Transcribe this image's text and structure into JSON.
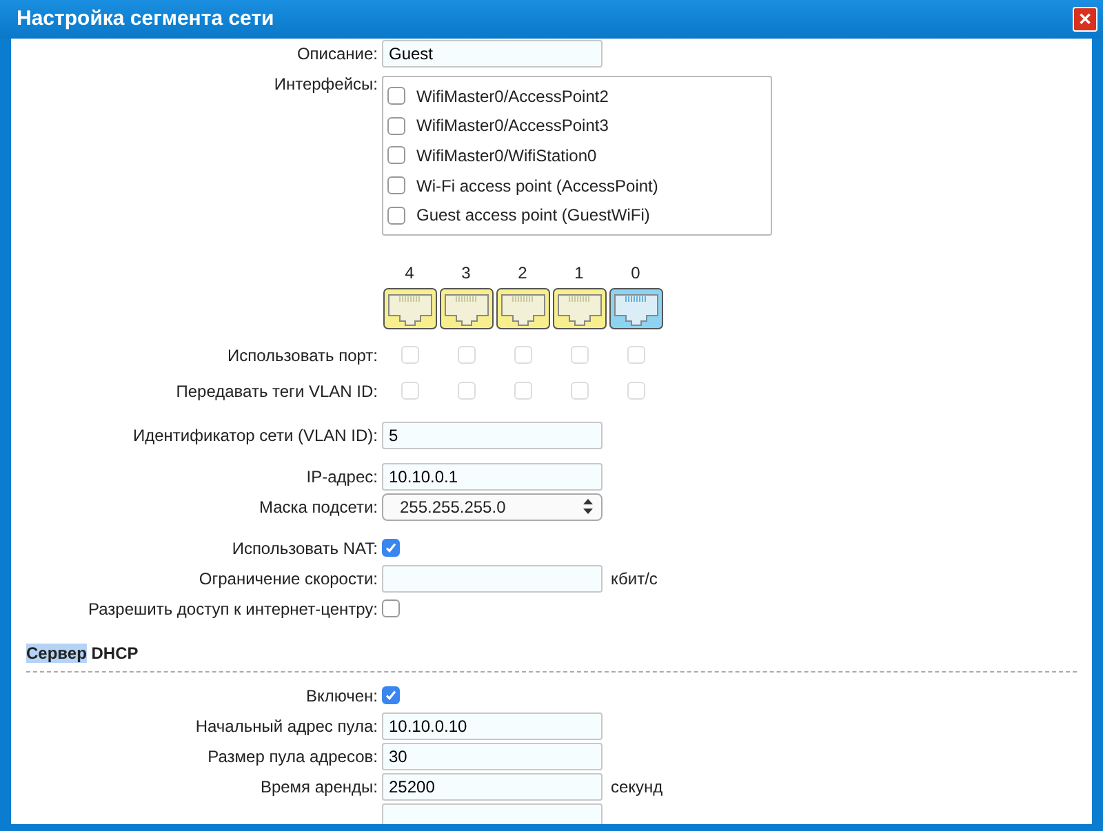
{
  "window": {
    "title": "Настройка сегмента сети",
    "close": "✕"
  },
  "groups": [
    {
      "rows": [
        {
          "kind": "field",
          "label": "Описание:",
          "value": "Guest"
        },
        {
          "kind": "checklist",
          "label": "Интерфейсы:",
          "items": [
            {
              "label": "WifiMaster0/AccessPoint2",
              "checked": false
            },
            {
              "label": "WifiMaster0/AccessPoint3",
              "checked": false
            },
            {
              "label": "WifiMaster0/WifiStation0",
              "checked": false
            },
            {
              "label": "Wi-Fi access point (AccessPoint)",
              "checked": false
            },
            {
              "label": "Guest access point (GuestWiFi)",
              "checked": false
            }
          ]
        }
      ]
    },
    {
      "rows": [
        {
          "kind": "ports",
          "ports": [
            {
              "number": "4",
              "kind": "lan"
            },
            {
              "number": "3",
              "kind": "lan"
            },
            {
              "number": "2",
              "kind": "lan"
            },
            {
              "number": "1",
              "kind": "lan"
            },
            {
              "number": "0",
              "kind": "wan"
            }
          ]
        },
        {
          "kind": "portchecks",
          "label": "Использовать порт:",
          "checks": [
            {
              "checked": false,
              "disabled": true
            },
            {
              "checked": false,
              "disabled": true
            },
            {
              "checked": false,
              "disabled": true
            },
            {
              "checked": false,
              "disabled": true
            },
            {
              "checked": false,
              "disabled": true
            }
          ]
        },
        {
          "kind": "portchecks",
          "label": "Передавать теги VLAN ID:",
          "checks": [
            {
              "checked": false,
              "disabled": true
            },
            {
              "checked": false,
              "disabled": true
            },
            {
              "checked": false,
              "disabled": true
            },
            {
              "checked": false,
              "disabled": true
            },
            {
              "checked": false,
              "disabled": true
            }
          ]
        }
      ]
    },
    {
      "rows": [
        {
          "kind": "field",
          "label": "Идентификатор сети (VLAN ID):",
          "value": "5"
        }
      ]
    },
    {
      "rows": [
        {
          "kind": "field",
          "label": "IP-адрес:",
          "value": "10.10.0.1"
        },
        {
          "kind": "select",
          "label": "Маска подсети:",
          "value": "255.255.255.0"
        }
      ]
    },
    {
      "rows": [
        {
          "kind": "checkbox",
          "label": "Использовать NAT:",
          "checked": true
        },
        {
          "kind": "field",
          "label": "Ограничение скорости:",
          "value": "",
          "unit": "кбит/с"
        },
        {
          "kind": "checkbox",
          "label": "Разрешить доступ к интернет-центру:",
          "checked": false
        }
      ]
    }
  ],
  "dhcp": {
    "heading": [
      {
        "text": "Сервер",
        "highlighted": true
      },
      {
        "text": "DHCP",
        "highlighted": false
      }
    ],
    "rows": [
      {
        "kind": "checkbox",
        "label": "Включен:",
        "checked": true
      },
      {
        "kind": "field",
        "label": "Начальный адрес пула:",
        "value": "10.10.0.10"
      },
      {
        "kind": "field",
        "label": "Размер пула адресов:",
        "value": "30"
      },
      {
        "kind": "field",
        "label": "Время аренды:",
        "value": "25200",
        "unit": "секунд"
      },
      {
        "kind": "field"
      }
    ]
  }
}
